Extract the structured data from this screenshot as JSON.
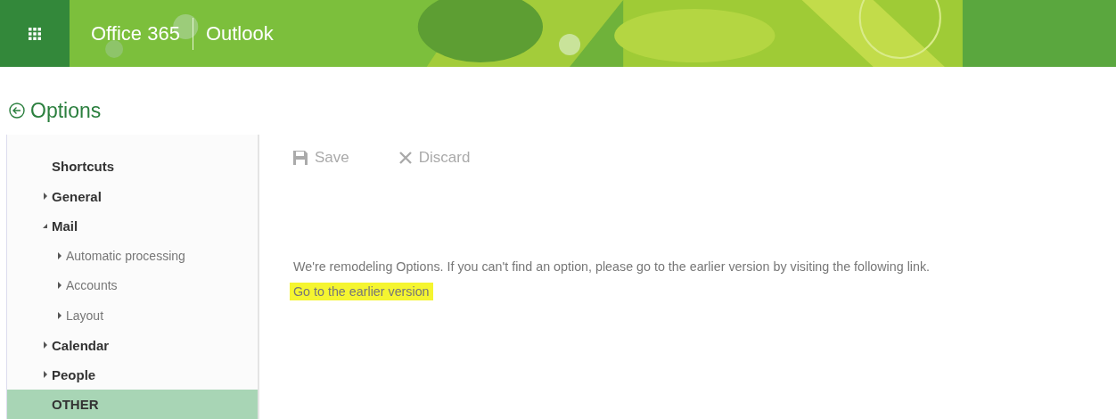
{
  "header": {
    "product": "Office 365",
    "app": "Outlook"
  },
  "page_title": "Options",
  "sidebar": {
    "items": [
      {
        "kind": "heading",
        "label": "Shortcuts",
        "selected": false
      },
      {
        "kind": "node",
        "label": "General",
        "expanded": false,
        "selected": false
      },
      {
        "kind": "node",
        "label": "Mail",
        "expanded": true,
        "selected": false,
        "children": [
          {
            "kind": "node",
            "label": "Automatic processing",
            "expanded": false,
            "selected": false
          },
          {
            "kind": "node",
            "label": "Accounts",
            "expanded": false,
            "selected": false
          },
          {
            "kind": "node",
            "label": "Layout",
            "expanded": false,
            "selected": false
          }
        ]
      },
      {
        "kind": "node",
        "label": "Calendar",
        "expanded": false,
        "selected": false
      },
      {
        "kind": "node",
        "label": "People",
        "expanded": false,
        "selected": false
      },
      {
        "kind": "heading",
        "label": "OTHER",
        "selected": true
      }
    ]
  },
  "toolbar": [
    {
      "kind": "save",
      "label": "Save",
      "disabled": true
    },
    {
      "kind": "discard",
      "label": "Discard",
      "disabled": true
    }
  ],
  "message": "We're remodeling Options. If you can't find an option, please go to the earlier version by visiting the following link.",
  "link": {
    "label": "Go to the earlier version",
    "highlighted": true
  }
}
